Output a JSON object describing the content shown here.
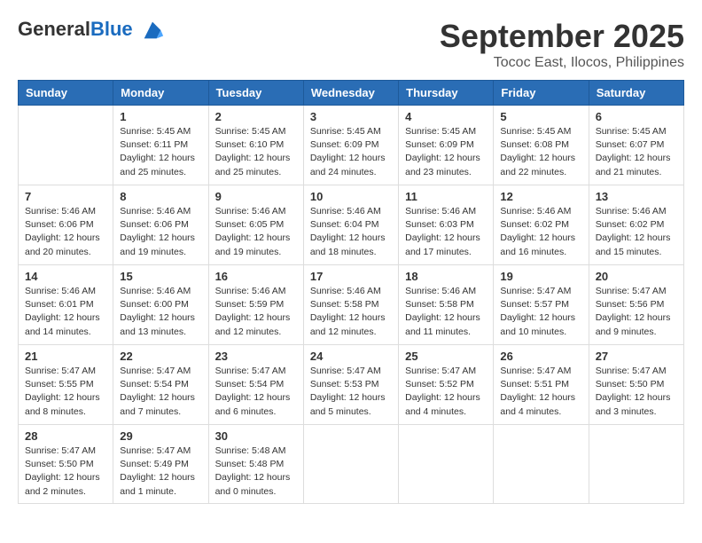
{
  "header": {
    "logo_general": "General",
    "logo_blue": "Blue",
    "month_title": "September 2025",
    "location": "Tococ East, Ilocos, Philippines"
  },
  "days_of_week": [
    "Sunday",
    "Monday",
    "Tuesday",
    "Wednesday",
    "Thursday",
    "Friday",
    "Saturday"
  ],
  "weeks": [
    [
      {
        "day": "",
        "info": ""
      },
      {
        "day": "1",
        "info": "Sunrise: 5:45 AM\nSunset: 6:11 PM\nDaylight: 12 hours\nand 25 minutes."
      },
      {
        "day": "2",
        "info": "Sunrise: 5:45 AM\nSunset: 6:10 PM\nDaylight: 12 hours\nand 25 minutes."
      },
      {
        "day": "3",
        "info": "Sunrise: 5:45 AM\nSunset: 6:09 PM\nDaylight: 12 hours\nand 24 minutes."
      },
      {
        "day": "4",
        "info": "Sunrise: 5:45 AM\nSunset: 6:09 PM\nDaylight: 12 hours\nand 23 minutes."
      },
      {
        "day": "5",
        "info": "Sunrise: 5:45 AM\nSunset: 6:08 PM\nDaylight: 12 hours\nand 22 minutes."
      },
      {
        "day": "6",
        "info": "Sunrise: 5:45 AM\nSunset: 6:07 PM\nDaylight: 12 hours\nand 21 minutes."
      }
    ],
    [
      {
        "day": "7",
        "info": "Sunrise: 5:46 AM\nSunset: 6:06 PM\nDaylight: 12 hours\nand 20 minutes."
      },
      {
        "day": "8",
        "info": "Sunrise: 5:46 AM\nSunset: 6:06 PM\nDaylight: 12 hours\nand 19 minutes."
      },
      {
        "day": "9",
        "info": "Sunrise: 5:46 AM\nSunset: 6:05 PM\nDaylight: 12 hours\nand 19 minutes."
      },
      {
        "day": "10",
        "info": "Sunrise: 5:46 AM\nSunset: 6:04 PM\nDaylight: 12 hours\nand 18 minutes."
      },
      {
        "day": "11",
        "info": "Sunrise: 5:46 AM\nSunset: 6:03 PM\nDaylight: 12 hours\nand 17 minutes."
      },
      {
        "day": "12",
        "info": "Sunrise: 5:46 AM\nSunset: 6:02 PM\nDaylight: 12 hours\nand 16 minutes."
      },
      {
        "day": "13",
        "info": "Sunrise: 5:46 AM\nSunset: 6:02 PM\nDaylight: 12 hours\nand 15 minutes."
      }
    ],
    [
      {
        "day": "14",
        "info": "Sunrise: 5:46 AM\nSunset: 6:01 PM\nDaylight: 12 hours\nand 14 minutes."
      },
      {
        "day": "15",
        "info": "Sunrise: 5:46 AM\nSunset: 6:00 PM\nDaylight: 12 hours\nand 13 minutes."
      },
      {
        "day": "16",
        "info": "Sunrise: 5:46 AM\nSunset: 5:59 PM\nDaylight: 12 hours\nand 12 minutes."
      },
      {
        "day": "17",
        "info": "Sunrise: 5:46 AM\nSunset: 5:58 PM\nDaylight: 12 hours\nand 12 minutes."
      },
      {
        "day": "18",
        "info": "Sunrise: 5:46 AM\nSunset: 5:58 PM\nDaylight: 12 hours\nand 11 minutes."
      },
      {
        "day": "19",
        "info": "Sunrise: 5:47 AM\nSunset: 5:57 PM\nDaylight: 12 hours\nand 10 minutes."
      },
      {
        "day": "20",
        "info": "Sunrise: 5:47 AM\nSunset: 5:56 PM\nDaylight: 12 hours\nand 9 minutes."
      }
    ],
    [
      {
        "day": "21",
        "info": "Sunrise: 5:47 AM\nSunset: 5:55 PM\nDaylight: 12 hours\nand 8 minutes."
      },
      {
        "day": "22",
        "info": "Sunrise: 5:47 AM\nSunset: 5:54 PM\nDaylight: 12 hours\nand 7 minutes."
      },
      {
        "day": "23",
        "info": "Sunrise: 5:47 AM\nSunset: 5:54 PM\nDaylight: 12 hours\nand 6 minutes."
      },
      {
        "day": "24",
        "info": "Sunrise: 5:47 AM\nSunset: 5:53 PM\nDaylight: 12 hours\nand 5 minutes."
      },
      {
        "day": "25",
        "info": "Sunrise: 5:47 AM\nSunset: 5:52 PM\nDaylight: 12 hours\nand 4 minutes."
      },
      {
        "day": "26",
        "info": "Sunrise: 5:47 AM\nSunset: 5:51 PM\nDaylight: 12 hours\nand 4 minutes."
      },
      {
        "day": "27",
        "info": "Sunrise: 5:47 AM\nSunset: 5:50 PM\nDaylight: 12 hours\nand 3 minutes."
      }
    ],
    [
      {
        "day": "28",
        "info": "Sunrise: 5:47 AM\nSunset: 5:50 PM\nDaylight: 12 hours\nand 2 minutes."
      },
      {
        "day": "29",
        "info": "Sunrise: 5:47 AM\nSunset: 5:49 PM\nDaylight: 12 hours\nand 1 minute."
      },
      {
        "day": "30",
        "info": "Sunrise: 5:48 AM\nSunset: 5:48 PM\nDaylight: 12 hours\nand 0 minutes."
      },
      {
        "day": "",
        "info": ""
      },
      {
        "day": "",
        "info": ""
      },
      {
        "day": "",
        "info": ""
      },
      {
        "day": "",
        "info": ""
      }
    ]
  ]
}
